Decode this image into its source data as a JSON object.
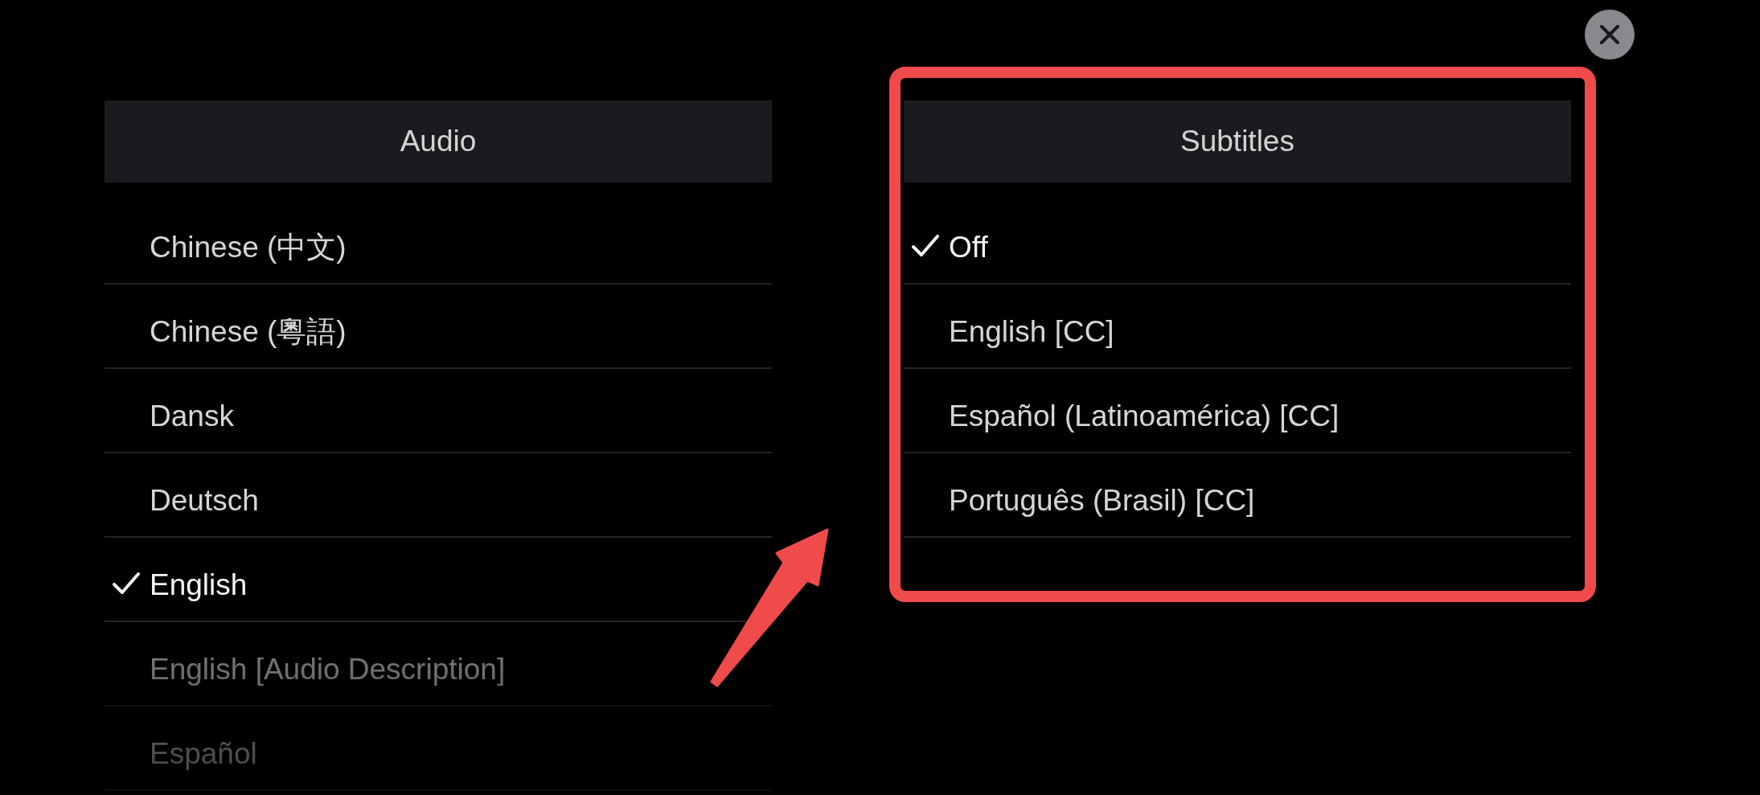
{
  "panels": [
    {
      "title": "Audio",
      "highlighted": false,
      "items": [
        {
          "label": "Chinese (中文)",
          "selected": false
        },
        {
          "label": "Chinese (粵語)",
          "selected": false
        },
        {
          "label": "Dansk",
          "selected": false
        },
        {
          "label": "Deutsch",
          "selected": false
        },
        {
          "label": "English",
          "selected": true
        },
        {
          "label": "English [Audio Description]",
          "selected": false
        },
        {
          "label": "Español",
          "selected": false
        }
      ]
    },
    {
      "title": "Subtitles",
      "highlighted": true,
      "items": [
        {
          "label": "Off",
          "selected": true
        },
        {
          "label": "English [CC]",
          "selected": false
        },
        {
          "label": "Español (Latinoamérica) [CC]",
          "selected": false
        },
        {
          "label": "Português (Brasil) [CC]",
          "selected": false
        }
      ]
    }
  ]
}
